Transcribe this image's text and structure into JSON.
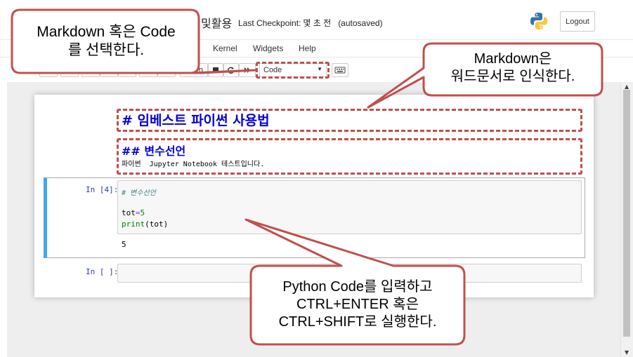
{
  "header": {
    "notebook_title": "및활용",
    "checkpoint_label": "Last Checkpoint:",
    "checkpoint_time": "몇 초 전",
    "autosave_status": "(autosaved)",
    "logout_label": "Logout"
  },
  "menubar": {
    "items": [
      "Kernel",
      "Widgets",
      "Help"
    ]
  },
  "toolbar": {
    "run_partial": "n",
    "cell_type_value": "Code"
  },
  "notebook": {
    "markdown_h1": "# 임베스트 파이썬 사용법",
    "markdown_h2": "## 변수선언",
    "markdown_paragraph": "파이썬  Jupyter Notebook 테스트입니다.",
    "code_cell": {
      "prompt": "In [4]:",
      "comment": "# 변수선언",
      "line2_name": "tot",
      "line2_op": "=",
      "line2_value": "5",
      "line3_fn": "print",
      "line3_args": "(tot)",
      "output": "5"
    },
    "empty_cell_prompt": "In [ ]:"
  },
  "annotations": {
    "callout_cell_type": [
      "Markdown 혹은 Code",
      "를 선택한다."
    ],
    "callout_markdown": [
      "Markdown은",
      "워드문서로 인식한다."
    ],
    "callout_run": [
      "Python Code를 입력하고",
      "CTRL+ENTER 혹은",
      "CTRL+SHIFT로 실행한다."
    ],
    "accent_color": "#c0504d"
  },
  "icons": {
    "logo": "python-logo-icon",
    "keyboard": "keyboard-icon"
  }
}
